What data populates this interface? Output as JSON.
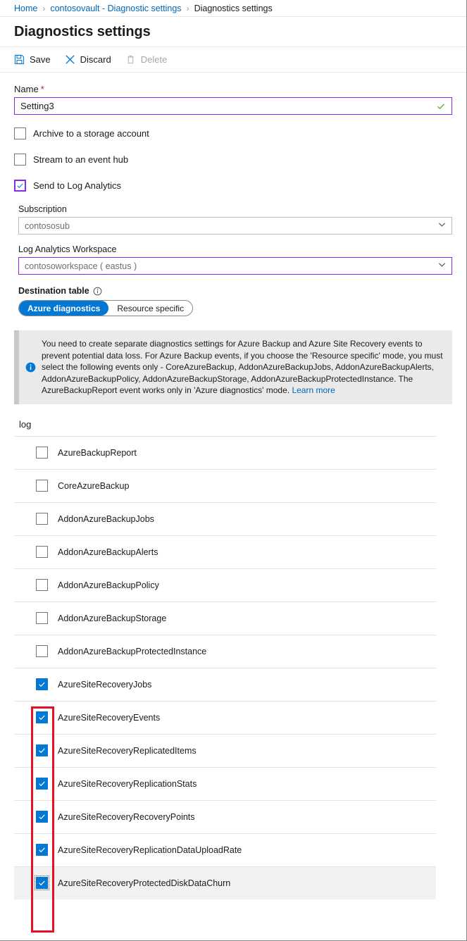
{
  "breadcrumb": {
    "items": [
      {
        "label": "Home",
        "link": true
      },
      {
        "label": "contosovault - Diagnostic settings",
        "link": true
      },
      {
        "label": "Diagnostics settings",
        "link": false
      }
    ],
    "separator": "›"
  },
  "header": {
    "title": "Diagnostics settings"
  },
  "toolbar": {
    "save_label": "Save",
    "discard_label": "Discard",
    "delete_label": "Delete"
  },
  "form": {
    "name_label": "Name",
    "name_required_mark": "*",
    "name_value": "Setting3",
    "name_placeholder": "",
    "archive_checkbox_label": "Archive to a storage account",
    "eventhub_checkbox_label": "Stream to an event hub",
    "loganalytics_checkbox_label": "Send to Log Analytics",
    "subscription_label": "Subscription",
    "subscription_value": "contososub",
    "workspace_label": "Log Analytics Workspace",
    "workspace_value": "contosoworkspace ( eastus )",
    "destination_table_label": "Destination table",
    "destination_options": [
      "Azure diagnostics",
      "Resource specific"
    ],
    "destination_selected": "Azure diagnostics"
  },
  "banner": {
    "text": "You need to create separate diagnostics settings for Azure Backup and Azure Site Recovery events to prevent potential data loss. For Azure Backup events, if you choose the 'Resource specific' mode, you must select the following events only - CoreAzureBackup, AddonAzureBackupJobs, AddonAzureBackupAlerts, AddonAzureBackupPolicy, AddonAzureBackupStorage, AddonAzureBackupProtectedInstance. The AzureBackupReport event works only in 'Azure diagnostics' mode. ",
    "link_label": "Learn more"
  },
  "log_section": {
    "header": "log",
    "rows": [
      {
        "label": "AzureBackupReport",
        "checked": false
      },
      {
        "label": "CoreAzureBackup",
        "checked": false
      },
      {
        "label": "AddonAzureBackupJobs",
        "checked": false
      },
      {
        "label": "AddonAzureBackupAlerts",
        "checked": false
      },
      {
        "label": "AddonAzureBackupPolicy",
        "checked": false
      },
      {
        "label": "AddonAzureBackupStorage",
        "checked": false
      },
      {
        "label": "AddonAzureBackupProtectedInstance",
        "checked": false
      },
      {
        "label": "AzureSiteRecoveryJobs",
        "checked": true
      },
      {
        "label": "AzureSiteRecoveryEvents",
        "checked": true
      },
      {
        "label": "AzureSiteRecoveryReplicatedItems",
        "checked": true
      },
      {
        "label": "AzureSiteRecoveryReplicationStats",
        "checked": true
      },
      {
        "label": "AzureSiteRecoveryRecoveryPoints",
        "checked": true
      },
      {
        "label": "AzureSiteRecoveryReplicationDataUploadRate",
        "checked": true
      },
      {
        "label": "AzureSiteRecoveryProtectedDiskDataChurn",
        "checked": true,
        "highlighted": true,
        "focused": true
      }
    ]
  },
  "colors": {
    "accent_blue": "#0078d4",
    "link_blue": "#0067b8",
    "focus_purple": "#8a2be2",
    "annotation_red": "#e81123",
    "valid_green": "#6ab023",
    "required_red": "#a4262c"
  }
}
